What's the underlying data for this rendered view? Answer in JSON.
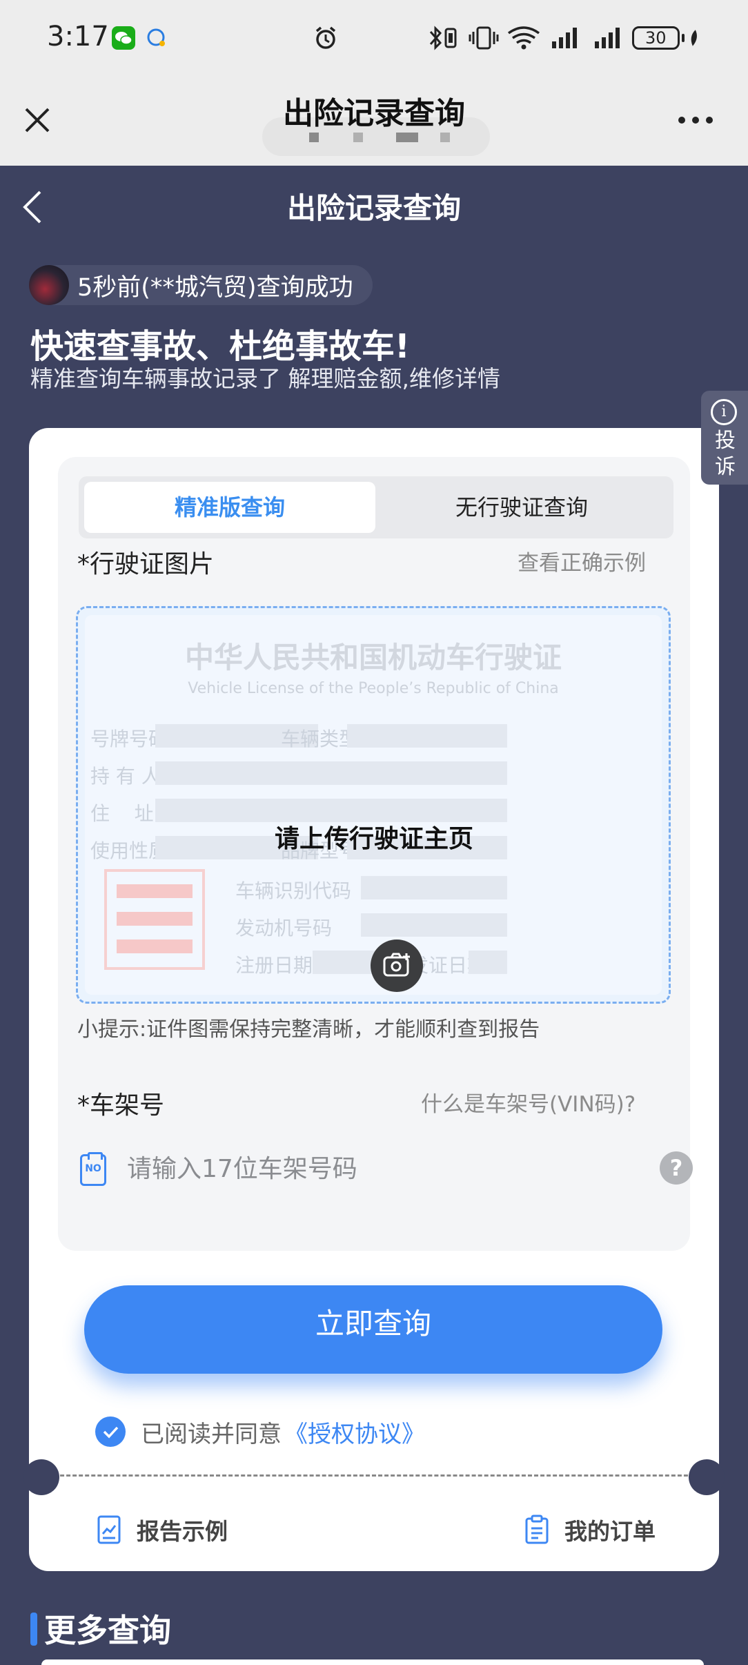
{
  "status": {
    "time": "3:17",
    "battery": "30"
  },
  "wechat": {
    "title": "出险记录查询"
  },
  "page": {
    "title": "出险记录查询",
    "ticker": "5秒前(**城汽贸)查询成功",
    "hero_title": "快速查事故、杜绝事故车!",
    "hero_subtitle": "精准查询车辆事故记录了 解理赔金额,维修详情",
    "complaint": "投诉"
  },
  "tabs": [
    {
      "label": "精准版查询"
    },
    {
      "label": "无行驶证查询"
    }
  ],
  "license": {
    "required_mark": "*",
    "label": "行驶证图片",
    "example_link": "查看正确示例",
    "card_title": "中华人民共和国机动车行驶证",
    "card_subtitle": "Vehicle License of the People’s Republic of China",
    "fields": {
      "plate": "号牌号码",
      "vehicle_type": "车辆类型",
      "owner": "持 有 人",
      "address": "住    址",
      "usage": "使用性质",
      "model": "品牌型号",
      "vin": "车辆识别代码",
      "engine": "发动机号码",
      "reg_date": "注册日期",
      "issue_date": "发证日期"
    },
    "upload_text": "请上传行驶证主页",
    "tip": "小提示:证件图需保持完整清晰，才能顺利查到报告"
  },
  "vin": {
    "required_mark": "*",
    "label": "车架号",
    "help_link": "什么是车架号(VIN码)?",
    "placeholder": "请输入17位车架号码",
    "icon_text": "NO"
  },
  "query_button": "立即查询",
  "agreement": {
    "text": "已阅读并同意",
    "link": "《授权协议》"
  },
  "footer": {
    "report_sample": "报告示例",
    "my_orders": "我的订单"
  },
  "more": {
    "title": "更多查询"
  }
}
